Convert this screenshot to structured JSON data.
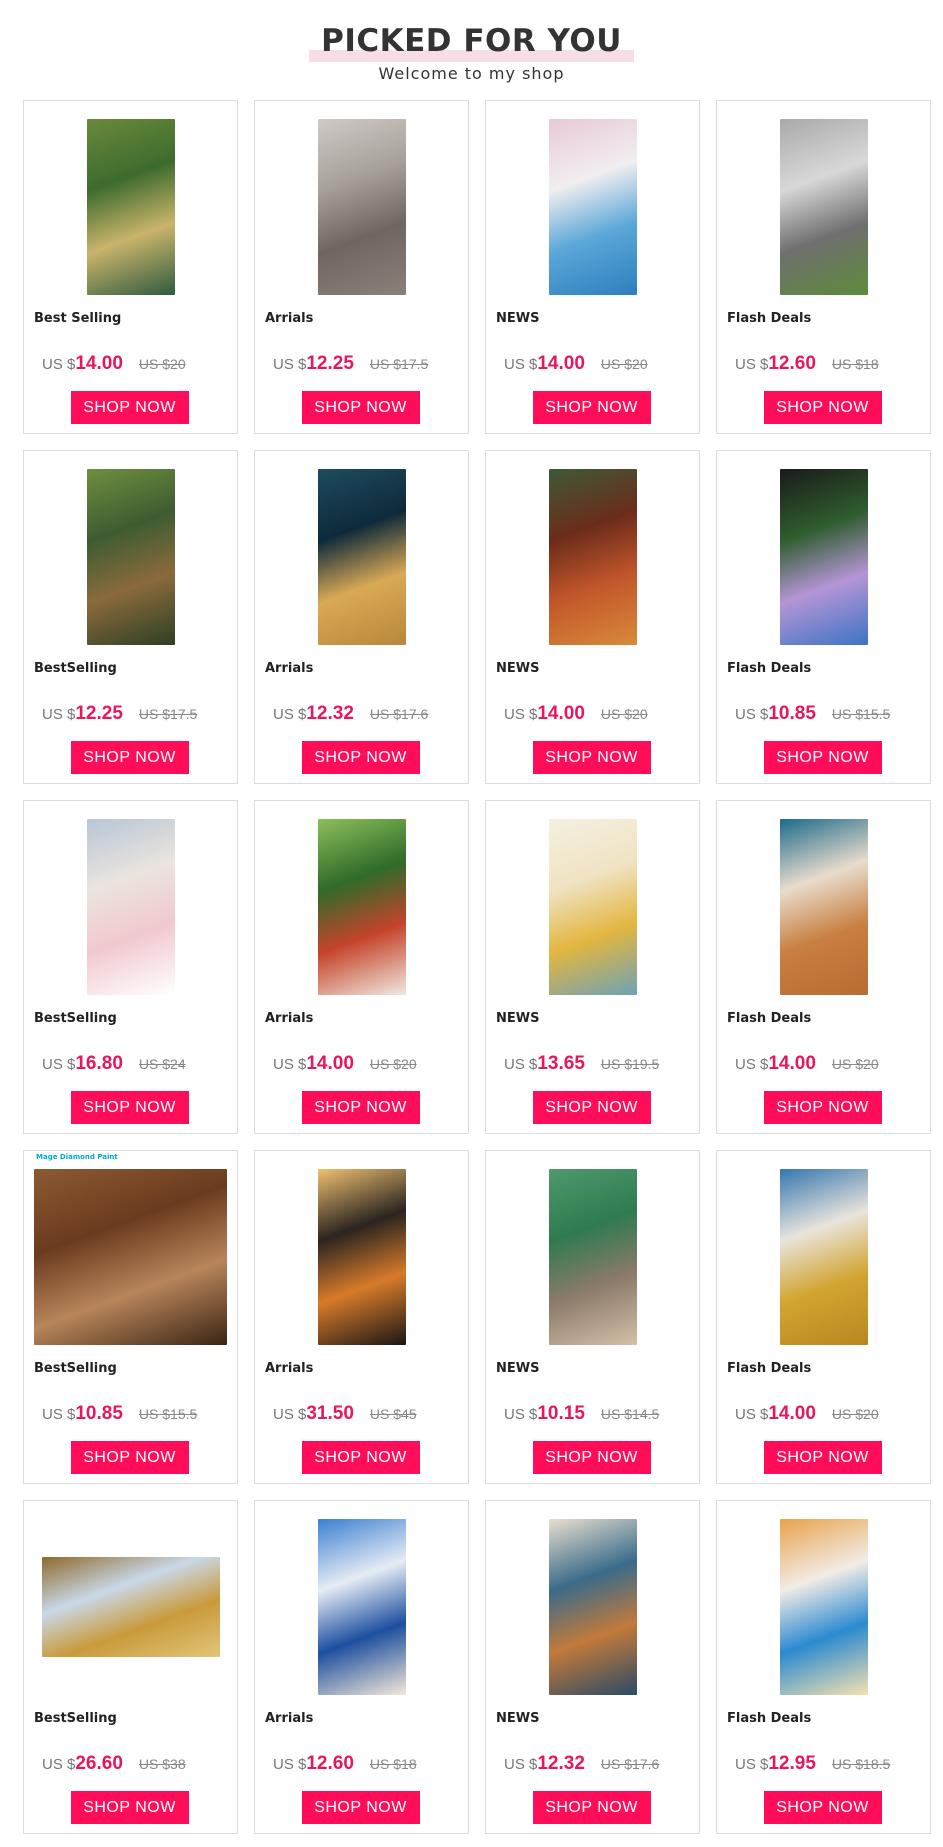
{
  "header": {
    "title": "PICKED FOR YOU",
    "subtitle": "Welcome to my shop"
  },
  "button_label": "SHOP NOW",
  "currency_prefix": "US $",
  "products": [
    {
      "category": "Best Selling",
      "price": "14.00",
      "old_price": "US $20",
      "image": "peacock-waterfall-painting",
      "colors": [
        "#3d6b2e",
        "#c9b46a",
        "#6a8a3a",
        "#2f5a40"
      ]
    },
    {
      "category": "Arrials",
      "price": "12.25",
      "old_price": "US $17.5",
      "image": "elephant-grey-painting",
      "colors": [
        "#a7a09a",
        "#6e6660",
        "#cfcac6",
        "#8a8279"
      ]
    },
    {
      "category": "NEWS",
      "price": "14.00",
      "old_price": "US $20",
      "image": "blue-peacock-lotus-painting",
      "colors": [
        "#f1eef0",
        "#5aa7d8",
        "#e8c9d7",
        "#2f7ebd"
      ]
    },
    {
      "category": "Flash Deals",
      "price": "12.60",
      "old_price": "US $18",
      "image": "elephant-family-grass-painting",
      "colors": [
        "#d8d8d8",
        "#6f6f6f",
        "#a9a9a9",
        "#5d8b3a"
      ]
    },
    {
      "category": "BestSelling",
      "price": "12.25",
      "old_price": "US $17.5",
      "image": "deer-forest-painting",
      "colors": [
        "#3e5c31",
        "#8a6a3c",
        "#6e8f3f",
        "#2d3f24"
      ]
    },
    {
      "category": "Arrials",
      "price": "12.32",
      "old_price": "US $17.6",
      "image": "golden-deer-night-painting",
      "colors": [
        "#0d2a3a",
        "#d9a955",
        "#1f4b5f",
        "#b8873a"
      ]
    },
    {
      "category": "NEWS",
      "price": "14.00",
      "old_price": "US $20",
      "image": "koi-pond-painting",
      "colors": [
        "#6b2c1a",
        "#c2562b",
        "#3d5a38",
        "#d88a3a"
      ]
    },
    {
      "category": "Flash Deals",
      "price": "10.85",
      "old_price": "US $15.5",
      "image": "black-cat-flowers-painting",
      "colors": [
        "#2f5d2e",
        "#b595d6",
        "#1a1a1a",
        "#3b74c4"
      ]
    },
    {
      "category": "BestSelling",
      "price": "16.80",
      "old_price": "US $24",
      "image": "white-deer-blossom-painting",
      "colors": [
        "#eae4de",
        "#f1c9cf",
        "#b7c6d6",
        "#ffffff"
      ]
    },
    {
      "category": "Arrials",
      "price": "14.00",
      "old_price": "US $20",
      "image": "koi-lily-pad-painting",
      "colors": [
        "#2f6b2a",
        "#c5432a",
        "#8cbf5a",
        "#f0e9df"
      ]
    },
    {
      "category": "NEWS",
      "price": "13.65",
      "old_price": "US $19.5",
      "image": "golden-deer-flowers-painting",
      "colors": [
        "#f0e3c3",
        "#e3b640",
        "#f5f0e0",
        "#6ea2b5"
      ]
    },
    {
      "category": "Flash Deals",
      "price": "14.00",
      "old_price": "US $20",
      "image": "peacock-orange-tail-painting",
      "colors": [
        "#e8dccd",
        "#c97f41",
        "#1d6a8a",
        "#b76c33"
      ]
    },
    {
      "category": "BestSelling",
      "price": "10.85",
      "old_price": "US $15.5",
      "image": "giraffe-lion-tiger-triptych",
      "colors": [
        "#6a3b1e",
        "#b8855a",
        "#8c5a32",
        "#3a2414"
      ],
      "wide": true,
      "badge": "Mage Diamond Paint"
    },
    {
      "category": "Arrials",
      "price": "31.50",
      "old_price": "US $45",
      "image": "tiger-crouching-painting",
      "colors": [
        "#2a2420",
        "#d77b2a",
        "#f0c070",
        "#1a1614"
      ]
    },
    {
      "category": "NEWS",
      "price": "10.15",
      "old_price": "US $14.5",
      "image": "elephant-jungle-painting",
      "colors": [
        "#2f7a52",
        "#8c7a6a",
        "#4e9a6b",
        "#d4c0a8"
      ]
    },
    {
      "category": "Flash Deals",
      "price": "14.00",
      "old_price": "US $20",
      "image": "golden-peacock-painting",
      "colors": [
        "#e9e4dc",
        "#d2a531",
        "#3476b0",
        "#b98621"
      ]
    },
    {
      "category": "BestSelling",
      "price": "26.60",
      "old_price": "US $38",
      "image": "lions-savanna-painting",
      "colors": [
        "#c9d8e8",
        "#c99a3a",
        "#8e6a2a",
        "#e2c67a"
      ],
      "land": true
    },
    {
      "category": "Arrials",
      "price": "12.60",
      "old_price": "US $18",
      "image": "blue-peacock-flowers-painting",
      "colors": [
        "#e6ecf4",
        "#1d4f9f",
        "#3b7fd0",
        "#f4e9d8"
      ]
    },
    {
      "category": "NEWS",
      "price": "12.32",
      "old_price": "US $17.6",
      "image": "ornate-elephant-painting",
      "colors": [
        "#3a6b8a",
        "#c27a3a",
        "#e9dfcf",
        "#2b4a66"
      ]
    },
    {
      "category": "Flash Deals",
      "price": "12.95",
      "old_price": "US $18.5",
      "image": "betta-fish-painting",
      "colors": [
        "#f2ece6",
        "#2b8ad0",
        "#e9a24a",
        "#f5e2b0"
      ]
    }
  ]
}
